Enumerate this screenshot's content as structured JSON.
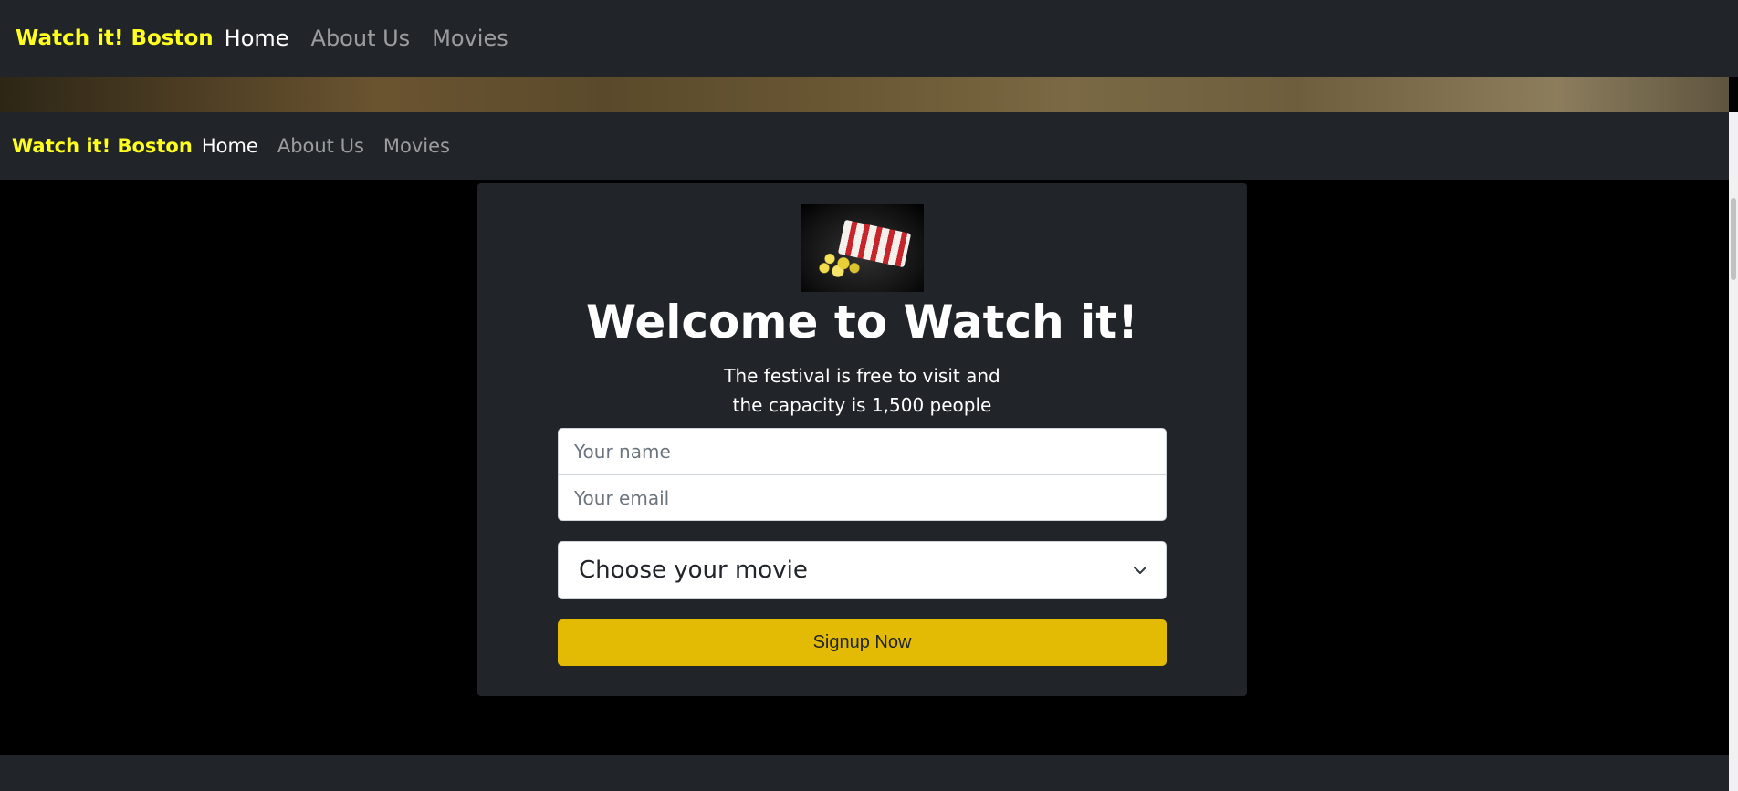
{
  "nav_top": {
    "brand": "Watch it! Boston",
    "links": [
      {
        "label": "Home",
        "active": true
      },
      {
        "label": "About Us",
        "active": false
      },
      {
        "label": "Movies",
        "active": false
      }
    ]
  },
  "nav_second": {
    "brand": "Watch it! Boston",
    "links": [
      {
        "label": "Home",
        "active": true
      },
      {
        "label": "About Us",
        "active": false
      },
      {
        "label": "Movies",
        "active": false
      }
    ]
  },
  "signup": {
    "title": "Welcome to Watch it!",
    "subtitle_line1": "The festival is free to visit and",
    "subtitle_line2": "the capacity is 1,500 people",
    "name_placeholder": "Your name",
    "email_placeholder": "Your email",
    "movie_select": "Choose your movie",
    "button_label": "Signup Now"
  },
  "colors": {
    "brand": "#ffff1f",
    "navbar_bg": "#212529",
    "page_bg": "#000000",
    "button_bg": "#e3bb05"
  }
}
